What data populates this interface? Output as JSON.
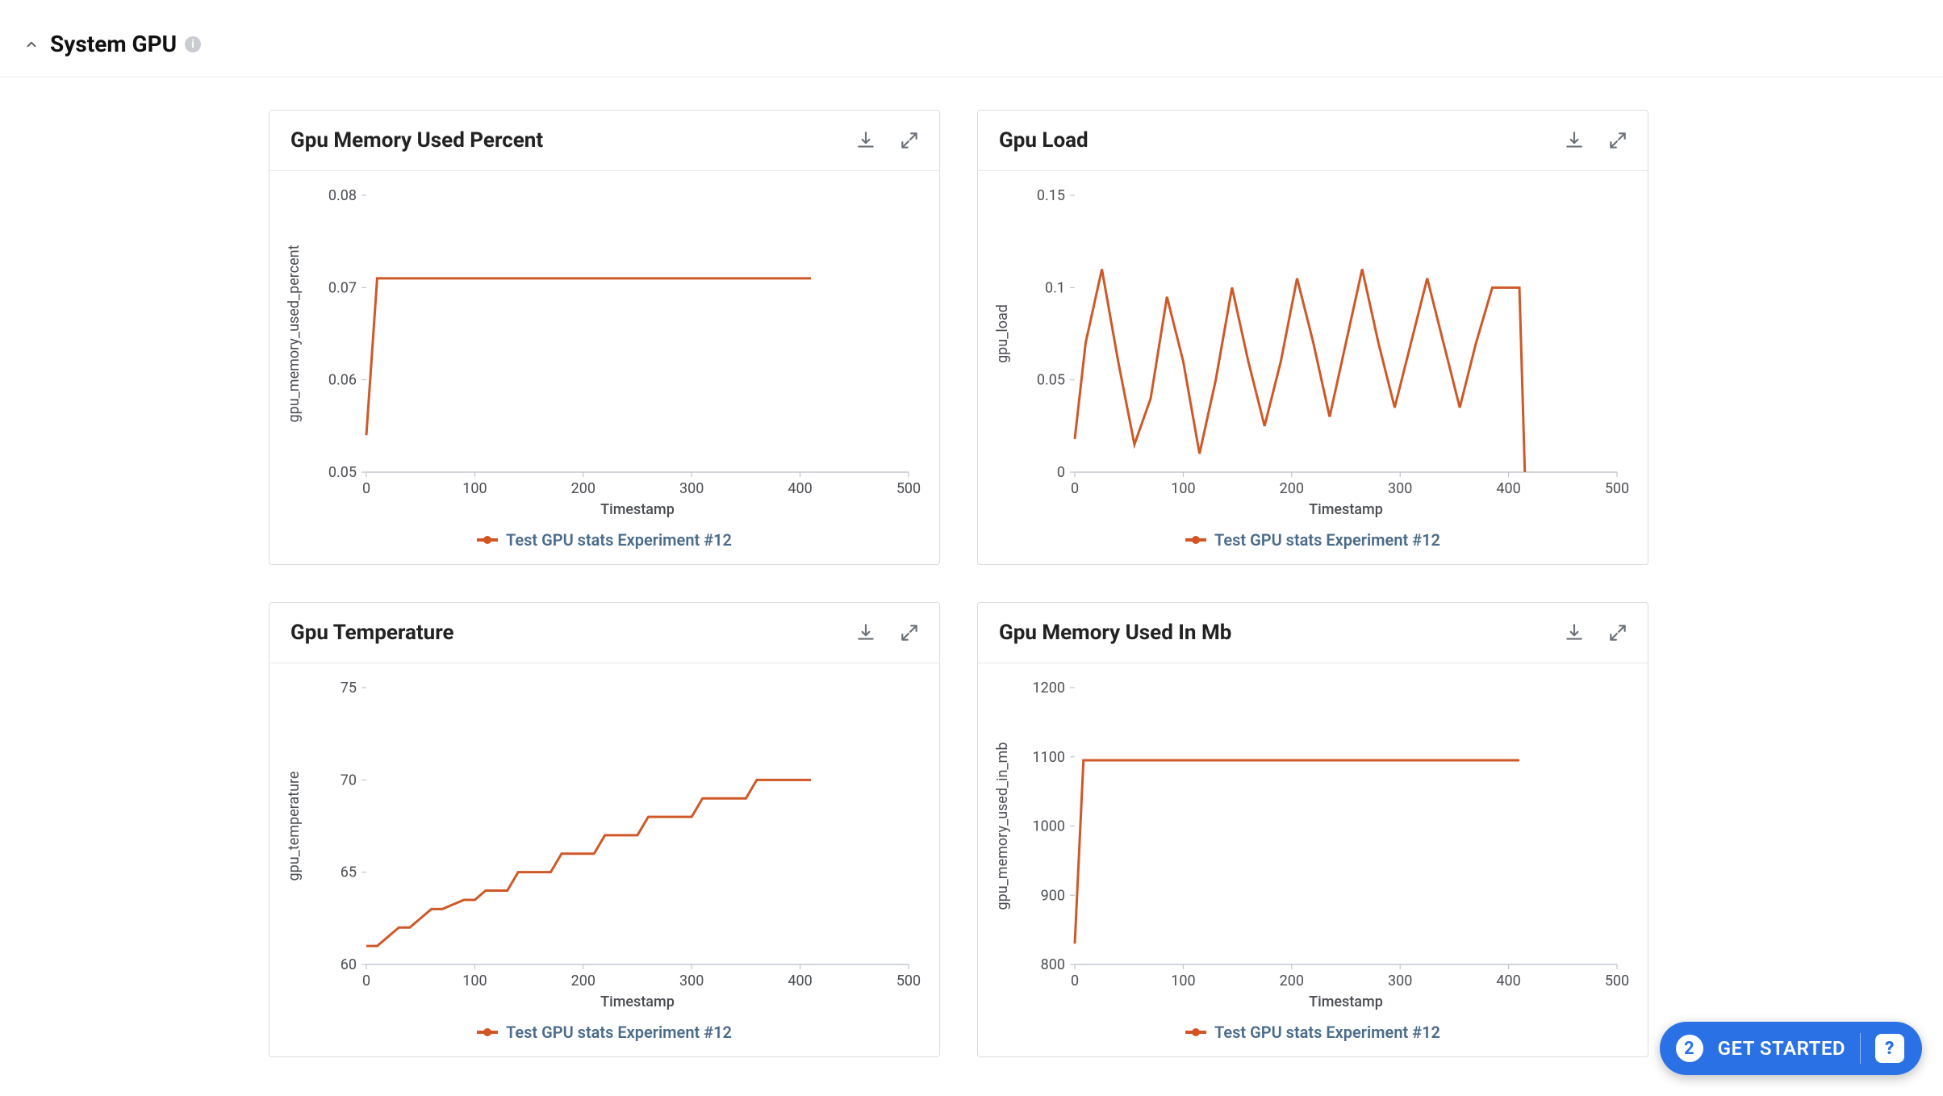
{
  "section": {
    "title": "System GPU"
  },
  "fab": {
    "count": "2",
    "label": "GET STARTED"
  },
  "colors": {
    "series": "#cf5828",
    "legend_text": "#4a6b8a"
  },
  "chart_data": [
    {
      "id": "gpu_memory_used_percent",
      "title": "Gpu Memory Used Percent",
      "type": "line",
      "xlabel": "Timestamp",
      "ylabel": "gpu_memory_used_percent",
      "legend": "Test GPU stats Experiment #12",
      "xlim": [
        0,
        500
      ],
      "ylim": [
        0.05,
        0.08
      ],
      "xticks": [
        0,
        100,
        200,
        300,
        400,
        500
      ],
      "yticks": [
        0.05,
        0.06,
        0.07,
        0.08
      ],
      "x": [
        0,
        10,
        20,
        50,
        100,
        200,
        300,
        400,
        410
      ],
      "values": [
        0.054,
        0.071,
        0.071,
        0.071,
        0.071,
        0.071,
        0.071,
        0.071,
        0.071
      ]
    },
    {
      "id": "gpu_load",
      "title": "Gpu Load",
      "type": "line",
      "xlabel": "Timestamp",
      "ylabel": "gpu_load",
      "legend": "Test GPU stats Experiment #12",
      "xlim": [
        0,
        500
      ],
      "ylim": [
        0,
        0.15
      ],
      "xticks": [
        0,
        100,
        200,
        300,
        400,
        500
      ],
      "yticks": [
        0,
        0.05,
        0.1,
        0.15
      ],
      "x": [
        0,
        10,
        25,
        40,
        55,
        70,
        85,
        100,
        115,
        130,
        145,
        160,
        175,
        190,
        205,
        220,
        235,
        250,
        265,
        280,
        295,
        310,
        325,
        340,
        355,
        370,
        385,
        400,
        410,
        415
      ],
      "values": [
        0.018,
        0.07,
        0.11,
        0.06,
        0.015,
        0.04,
        0.095,
        0.06,
        0.01,
        0.05,
        0.1,
        0.06,
        0.025,
        0.06,
        0.105,
        0.07,
        0.03,
        0.07,
        0.11,
        0.07,
        0.035,
        0.07,
        0.105,
        0.07,
        0.035,
        0.07,
        0.1,
        0.1,
        0.1,
        0.0
      ]
    },
    {
      "id": "gpu_temperature",
      "title": "Gpu Temperature",
      "type": "line",
      "xlabel": "Timestamp",
      "ylabel": "gpu_temperature",
      "legend": "Test GPU stats Experiment #12",
      "xlim": [
        0,
        500
      ],
      "ylim": [
        60,
        75
      ],
      "xticks": [
        0,
        100,
        200,
        300,
        400,
        500
      ],
      "yticks": [
        60,
        65,
        70,
        75
      ],
      "x": [
        0,
        10,
        30,
        40,
        60,
        70,
        90,
        100,
        110,
        130,
        140,
        170,
        180,
        210,
        220,
        250,
        260,
        300,
        310,
        350,
        360,
        410
      ],
      "values": [
        61,
        61,
        62,
        62,
        63,
        63,
        63.5,
        63.5,
        64,
        64,
        65,
        65,
        66,
        66,
        67,
        67,
        68,
        68,
        69,
        69,
        70,
        70
      ]
    },
    {
      "id": "gpu_memory_used_in_mb",
      "title": "Gpu Memory Used In Mb",
      "type": "line",
      "xlabel": "Timestamp",
      "ylabel": "gpu_memory_used_in_mb",
      "legend": "Test GPU stats Experiment #12",
      "xlim": [
        0,
        500
      ],
      "ylim": [
        800,
        1200
      ],
      "xticks": [
        0,
        100,
        200,
        300,
        400,
        500
      ],
      "yticks": [
        800,
        900,
        1000,
        1100,
        1200
      ],
      "x": [
        0,
        8,
        20,
        50,
        100,
        200,
        300,
        400,
        410
      ],
      "values": [
        830,
        1095,
        1095,
        1095,
        1095,
        1095,
        1095,
        1095,
        1095
      ]
    }
  ]
}
